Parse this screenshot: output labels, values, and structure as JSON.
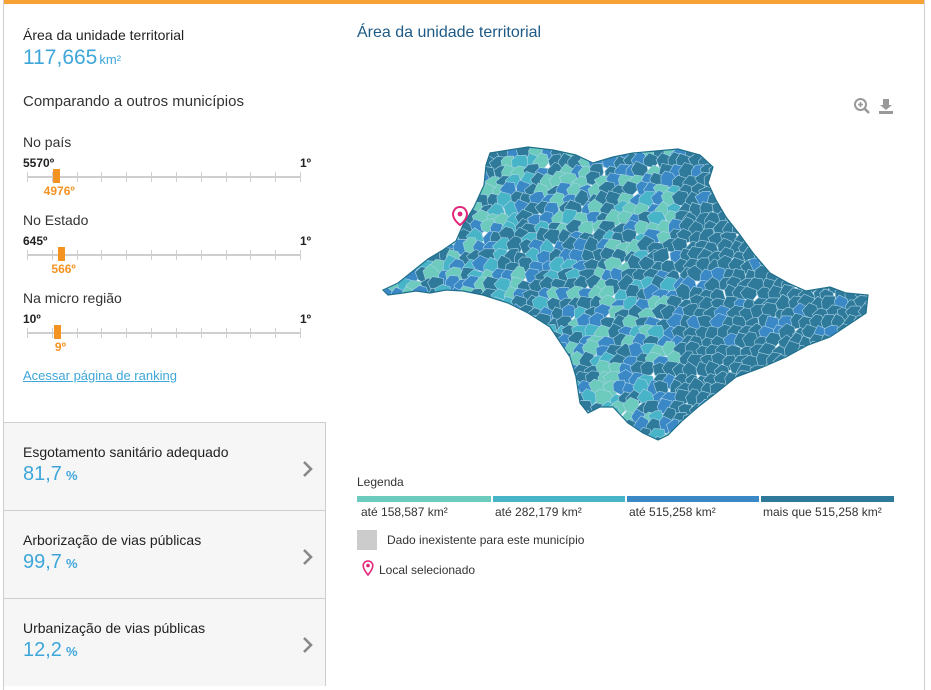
{
  "indicator": {
    "title": "Área da unidade territorial",
    "value": "117,665",
    "unit": "km²"
  },
  "compare": {
    "title": "Comparando a outros municípios",
    "rankings": [
      {
        "label": "No país",
        "min": "5570º",
        "max": "1º",
        "position": "4976º",
        "total": 5570,
        "rank": 4976
      },
      {
        "label": "No Estado",
        "min": "645º",
        "max": "1º",
        "position": "566º",
        "total": 645,
        "rank": 566
      },
      {
        "label": "Na micro região",
        "min": "10º",
        "max": "1º",
        "position": "9º",
        "total": 10,
        "rank": 9
      }
    ],
    "link": "Acessar página de ranking"
  },
  "cards": [
    {
      "title": "Esgotamento sanitário adequado",
      "value": "81,7",
      "unit": "%"
    },
    {
      "title": "Arborização de vias públicas",
      "value": "99,7",
      "unit": "%"
    },
    {
      "title": "Urbanização de vias públicas",
      "value": "12,2",
      "unit": "%"
    }
  ],
  "map": {
    "title": "Área da unidade territorial",
    "tools": {
      "zoom": "zoom-in-icon",
      "download": "download-icon"
    }
  },
  "legend": {
    "title": "Legenda",
    "classes": [
      {
        "label": "até 158,587 km²",
        "color": "#6ccbbd"
      },
      {
        "label": "até 282,179 km²",
        "color": "#48b4c8"
      },
      {
        "label": "até 515,258 km²",
        "color": "#3b88c7"
      },
      {
        "label": "mais que 515,258 km²",
        "color": "#2f7a9a"
      }
    ],
    "missing": {
      "label": "Dado inexistente para este município",
      "color": "#cccccc"
    },
    "selected": {
      "label": "Local selecionado",
      "color": "#e0267a"
    }
  }
}
